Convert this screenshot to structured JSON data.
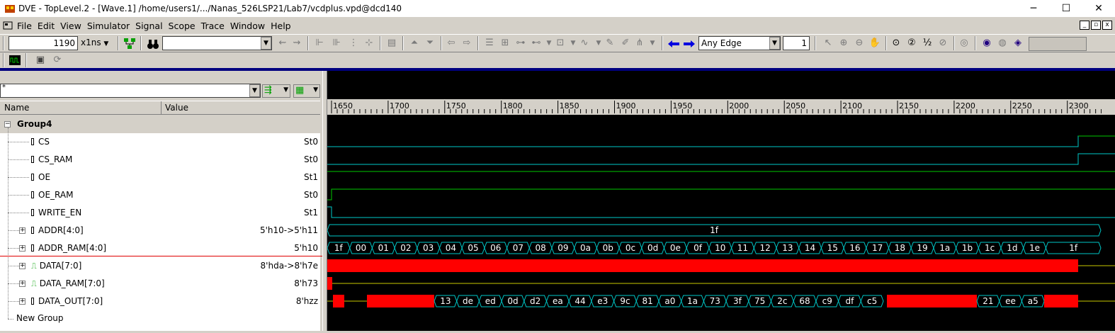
{
  "window": {
    "title": "DVE - TopLevel.2 - [Wave.1]  /home/users1/.../Nanas_526LSP21/Lab7/vcdplus.vpd@dcd140",
    "minimize": "─",
    "maximize": "☐",
    "close": "✕"
  },
  "menu": [
    "File",
    "Edit",
    "View",
    "Simulator",
    "Signal",
    "Scope",
    "Trace",
    "Window",
    "Help"
  ],
  "toolbar": {
    "time_value": "1190",
    "time_unit": "x1ns",
    "search_value": "",
    "edge_select": "Any Edge",
    "edge_count": "1"
  },
  "filter": {
    "value": "*"
  },
  "columns": {
    "name": "Name",
    "value": "Value"
  },
  "group": {
    "name": "Group4"
  },
  "signals": [
    {
      "name": "CS",
      "value": "St0",
      "bus": false
    },
    {
      "name": "CS_RAM",
      "value": "St0",
      "bus": false
    },
    {
      "name": "OE",
      "value": "St1",
      "bus": false
    },
    {
      "name": "OE_RAM",
      "value": "St0",
      "bus": false
    },
    {
      "name": "WRITE_EN",
      "value": "St1",
      "bus": false
    },
    {
      "name": "ADDR[4:0]",
      "value": "5'h10->5'h11",
      "bus": true
    },
    {
      "name": "ADDR_RAM[4:0]",
      "value": "5'h10",
      "bus": true
    },
    {
      "name": "DATA[7:0]",
      "value": "8'hda->8'h7e",
      "bus": true
    },
    {
      "name": "DATA_RAM[7:0]",
      "value": "8'h73",
      "bus": true
    },
    {
      "name": "DATA_OUT[7:0]",
      "value": "8'hzz",
      "bus": true
    }
  ],
  "new_group": "New Group",
  "ruler": {
    "start": 1650,
    "end": 2300,
    "step": 50,
    "labels": [
      "1650",
      "1700",
      "1750",
      "1800",
      "1850",
      "1900",
      "1950",
      "2000",
      "2050",
      "2100",
      "2150",
      "2200",
      "2250",
      "2300"
    ]
  },
  "waves": {
    "addr_value": "1f",
    "addr_ram_values": [
      "1f",
      "00",
      "01",
      "02",
      "03",
      "04",
      "05",
      "06",
      "07",
      "08",
      "09",
      "0a",
      "0b",
      "0c",
      "0d",
      "0e",
      "0f",
      "10",
      "11",
      "12",
      "13",
      "14",
      "15",
      "16",
      "17",
      "18",
      "19",
      "1a",
      "1b",
      "1c",
      "1d",
      "1e",
      "1f"
    ],
    "data_out_values": [
      "13",
      "de",
      "ed",
      "0d",
      "d2",
      "ea",
      "44",
      "e3",
      "9c",
      "81",
      "a0",
      "1a",
      "73",
      "3f",
      "75",
      "2c",
      "68",
      "c9",
      "df",
      "c5",
      "21",
      "ee",
      "a5"
    ]
  },
  "colors": {
    "cyan": "#00c8c8",
    "green": "#00c800",
    "yellow": "#c8c800",
    "red": "#ff0000",
    "blue": "#00007f"
  }
}
